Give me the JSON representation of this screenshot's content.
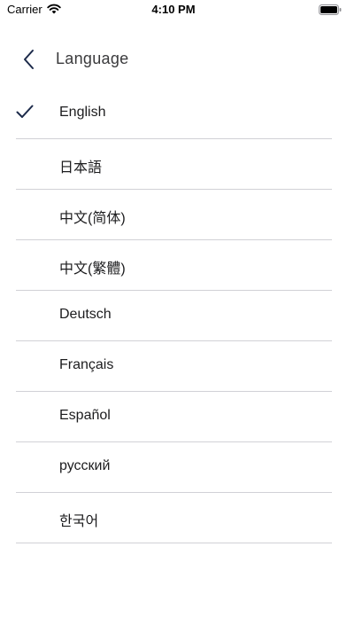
{
  "status_bar": {
    "carrier": "Carrier",
    "time": "4:10 PM"
  },
  "header": {
    "title": "Language",
    "back_icon": "chevron-left-icon"
  },
  "languages": {
    "selected_index": 0,
    "items": [
      {
        "label": "English"
      },
      {
        "label": "日本語"
      },
      {
        "label": "中文(简体)"
      },
      {
        "label": "中文(繁體)"
      },
      {
        "label": "Deutsch"
      },
      {
        "label": "Français"
      },
      {
        "label": "Español"
      },
      {
        "label": "русский"
      },
      {
        "label": "한국어"
      }
    ]
  },
  "colors": {
    "accent": "#1c2a4a",
    "separator": "#d1d1d6",
    "text": "#1c1c1e"
  }
}
